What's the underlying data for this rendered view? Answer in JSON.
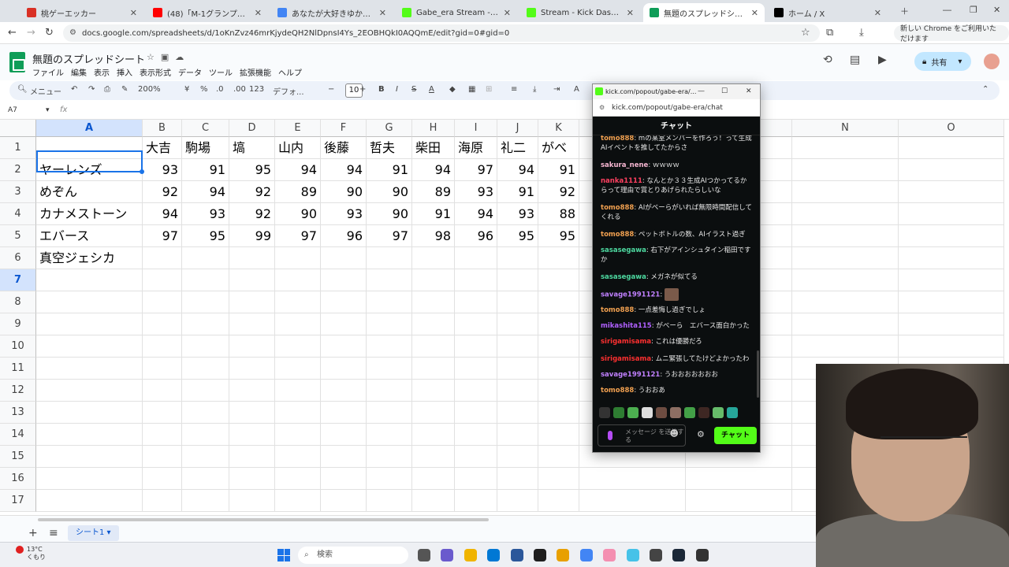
{
  "browser": {
    "tabs": [
      {
        "title": "桃ゲーエッカー",
        "color": "#d93025"
      },
      {
        "title": "(48)「M-1グランプリを観ながら評…",
        "color": "#ff0000"
      },
      {
        "title": "あなたが大好きゆかりちゃんー(人…",
        "color": "#4285f4"
      },
      {
        "title": "Gabe_era Stream - Watch Live",
        "color": "#53fc18"
      },
      {
        "title": "Stream - Kick Dashboard",
        "color": "#53fc18"
      },
      {
        "title": "無題のスプレッドシート - Google ス",
        "color": "#0f9d58"
      },
      {
        "title": "ホーム / X",
        "color": "#000000"
      }
    ],
    "url": "docs.google.com/spreadsheets/d/1oKnZvz46mrKjydeQH2NlDpnsI4Ys_2EOBHQkI0AQQmE/edit?gid=0#gid=0",
    "banner": "新しい Chrome をご利用いただけます"
  },
  "sheets": {
    "title": "無題のスプレッドシート",
    "menu": [
      "ファイル",
      "編集",
      "表示",
      "挿入",
      "表示形式",
      "データ",
      "ツール",
      "拡張機能",
      "ヘルプ"
    ],
    "share": "共有",
    "toolbar": {
      "search": "メニュー",
      "zoom": "200%",
      "currency": "¥",
      "percent": "%",
      "dec_dec": ".0",
      "dec_inc": ".00",
      "num_fmt": "123",
      "font": "デフォ...",
      "font_size": "10"
    },
    "namebox": "A7",
    "fx": "fx",
    "columns": [
      "A",
      "B",
      "C",
      "D",
      "E",
      "F",
      "G",
      "H",
      "I",
      "J",
      "K",
      "L",
      "M",
      "N",
      "O"
    ],
    "rows": [
      "1",
      "2",
      "3",
      "4",
      "5",
      "6",
      "7",
      "8",
      "9",
      "10",
      "11",
      "12",
      "13",
      "14",
      "15",
      "16",
      "17"
    ],
    "header_row": [
      "",
      "大吉",
      "駒場",
      "塙",
      "山内",
      "後藤",
      "哲夫",
      "柴田",
      "海原",
      "礼二",
      "がべ"
    ],
    "data_rows": [
      [
        "ヤーレンズ",
        "93",
        "91",
        "95",
        "94",
        "94",
        "91",
        "94",
        "97",
        "94",
        "91"
      ],
      [
        "めぞん",
        "92",
        "94",
        "92",
        "89",
        "90",
        "90",
        "89",
        "93",
        "91",
        "92"
      ],
      [
        "カナメストーン",
        "94",
        "93",
        "92",
        "90",
        "93",
        "90",
        "91",
        "94",
        "93",
        "88"
      ],
      [
        "エバース",
        "97",
        "95",
        "99",
        "97",
        "96",
        "97",
        "98",
        "96",
        "95",
        "95"
      ],
      [
        "真空ジェシカ",
        "",
        "",
        "",
        "",
        "",
        "",
        "",
        "",
        "",
        ""
      ]
    ],
    "sheet_tab": "シート1"
  },
  "kick": {
    "window_title": "kick.com/popout/gabe-era/...",
    "url": "kick.com/popout/gabe-era/chat",
    "header": "チャット",
    "messages": [
      {
        "user": "tomo888",
        "color": "#f0a050",
        "text": "mの某室メンバーを作ろう！って生成AIイベントを推してたからさ"
      },
      {
        "user": "sakura_nene",
        "color": "#f7b7d2",
        "text": "ｗｗｗｗ"
      },
      {
        "user": "nanka1111",
        "color": "#ff4060",
        "text": "なんとか３３生成AIつかってるからって理由で賞とりあげられたらしいな"
      },
      {
        "user": "tomo888",
        "color": "#f0a050",
        "text": "AIがベーらがいれば無限時間配信してくれる"
      },
      {
        "user": "tomo888",
        "color": "#f0a050",
        "text": "ペットボトルの数、AIイラスト過ぎ"
      },
      {
        "user": "sasasegawa",
        "color": "#4dd9a0",
        "text": "右下がアインシュタイン稲田ですか"
      },
      {
        "user": "sasasegawa",
        "color": "#4dd9a0",
        "text": "メガネが似てる"
      },
      {
        "user": "savage1991121",
        "color": "#c080ff",
        "text": ""
      },
      {
        "user": "tomo888",
        "color": "#f0a050",
        "text": "一点差悔し過ぎでしょ"
      },
      {
        "user": "mikashita115",
        "color": "#b060ff",
        "text": "がべーら　エバース面白かった"
      },
      {
        "user": "sirigamisama",
        "color": "#ff3030",
        "text": "これは優勝だろ"
      },
      {
        "user": "sirigamisama",
        "color": "#ff3030",
        "text": "ムニ緊張してたけどよかったわ"
      },
      {
        "user": "savage1991121",
        "color": "#c080ff",
        "text": "うおおおおおおお"
      },
      {
        "user": "tomo888",
        "color": "#f0a050",
        "text": "うおおあ"
      }
    ],
    "input_placeholder": "メッセージ を送信する",
    "send": "チャット"
  },
  "taskbar": {
    "temp": "13°C",
    "weather": "くもり",
    "search": "検索"
  }
}
